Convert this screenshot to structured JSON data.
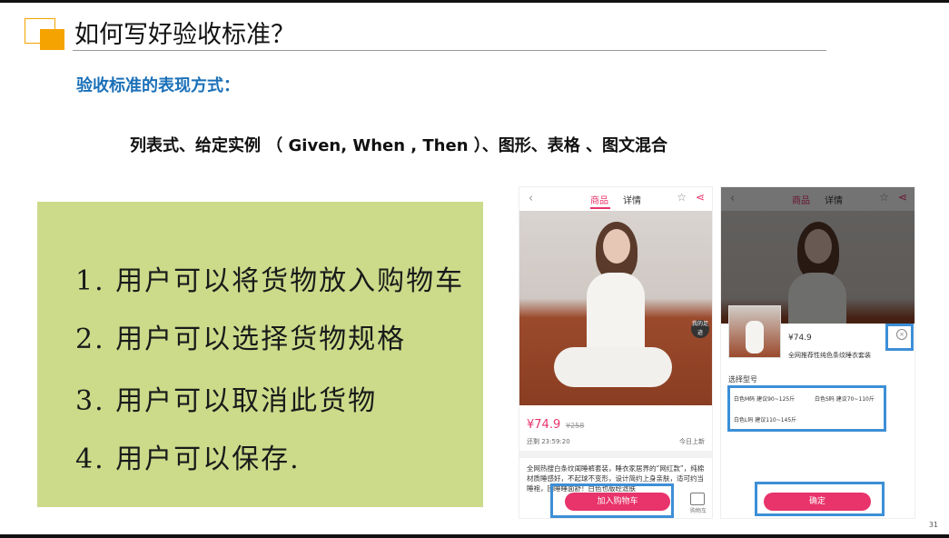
{
  "slide": {
    "title": "如何写好验收标准？",
    "subtitle": "验收标准的表现方式：",
    "methods": "列表式、给定实例 （ Given, When , Then ）、图形、表格 、图文混合",
    "page_number": "31"
  },
  "note": {
    "lines": [
      "1. 用户可以将货物放入购物车",
      "2. 用户可以选择货物规格",
      "3. 用户可以取消此货物",
      "4. 用户可以保存."
    ]
  },
  "phone1": {
    "tab_product": "商品",
    "tab_detail": "详情",
    "badge": "我的足迹",
    "price": "¥74.9",
    "old_price": "¥258",
    "timer": "还剩 23:59:20",
    "today": "今日上新",
    "description": "全网热搜白条纹闺睡裤套装，睡衣家居界的“网红款”，纯棉材质睡感好，不起球不变形，设计简约上身亲肤，适可约当睡袍，回睡睡面舒！白色也版经滤肤",
    "add_to_cart": "加入购物车",
    "cart_label": "购物车",
    "cart_count": "0"
  },
  "phone2": {
    "tab_product": "商品",
    "tab_detail": "详情",
    "price": "¥74.9",
    "name": "全网推荐性纯色条纹睡衣套装",
    "close": "×",
    "select_label": "选择型号",
    "options": [
      "白色M码 建议90~125斤",
      "白色S码 建议70~110斤",
      "白色L码 建议110~145斤"
    ],
    "confirm": "确定"
  }
}
